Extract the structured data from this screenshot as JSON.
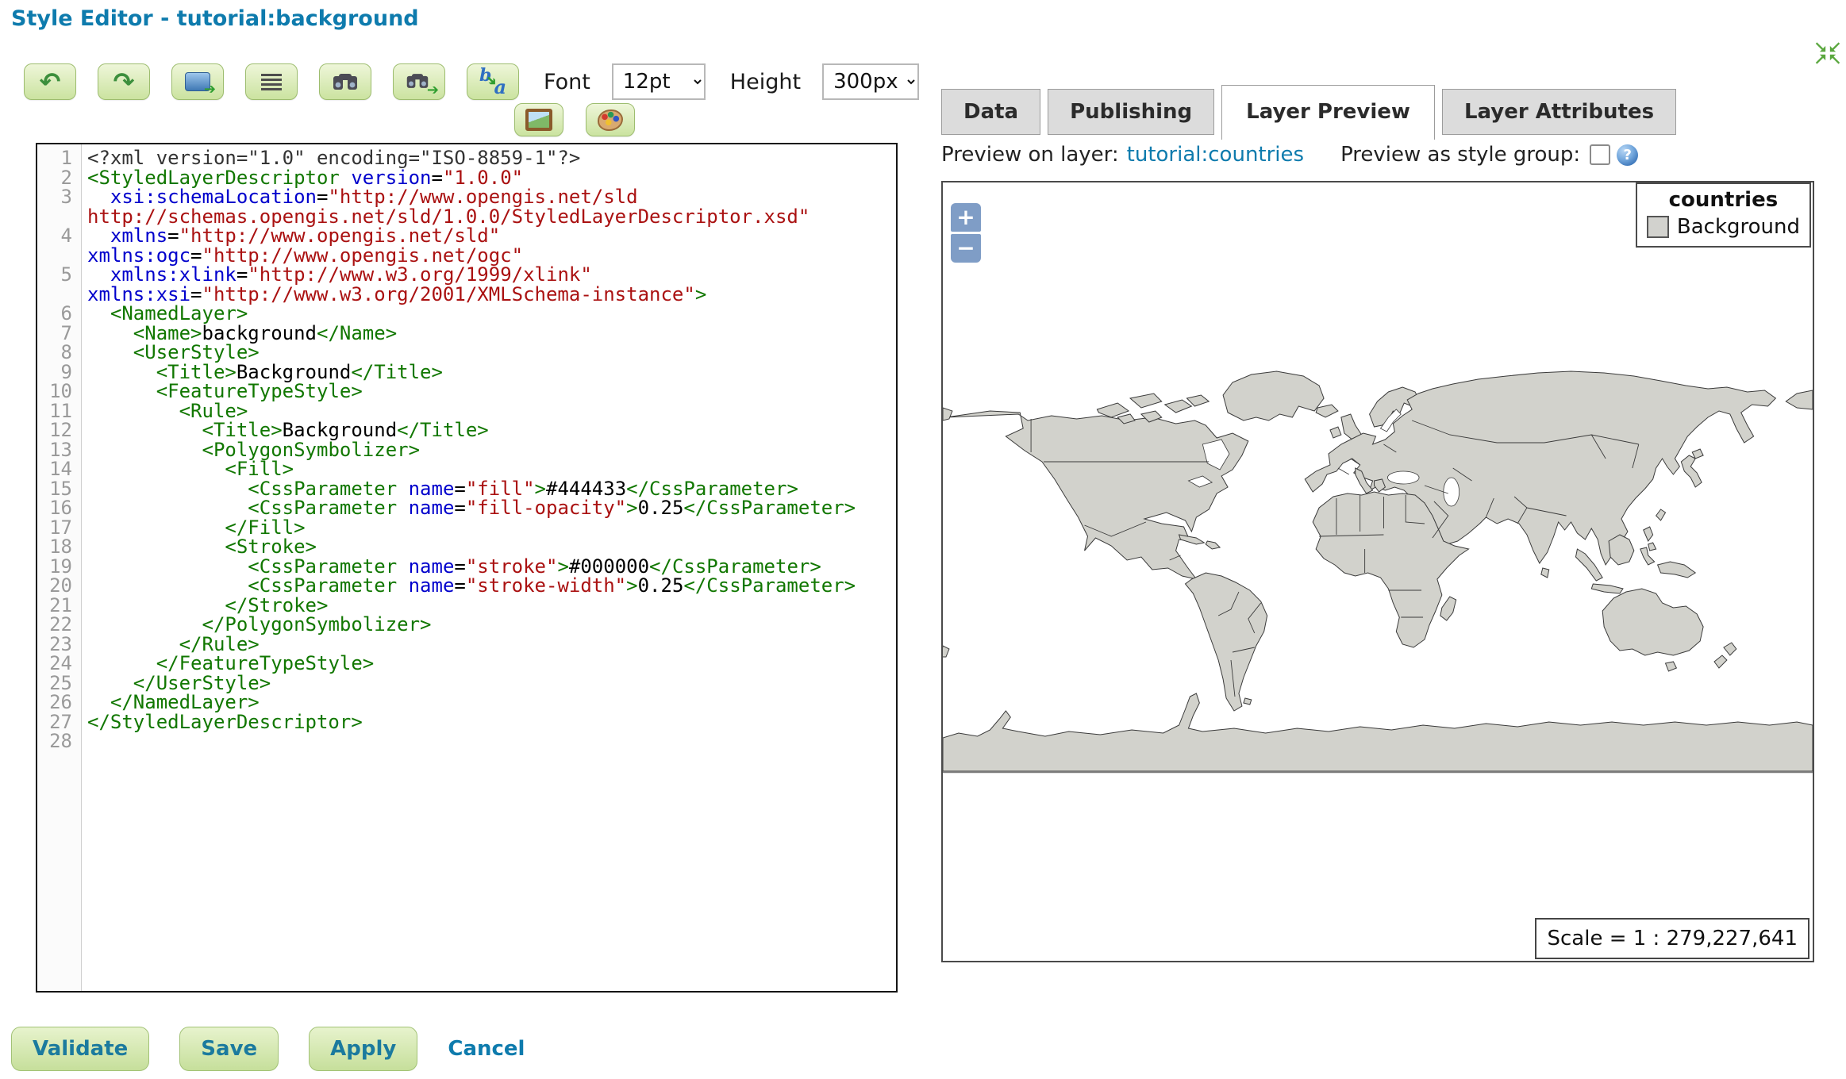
{
  "title": "Style Editor - tutorial:background",
  "colors": {
    "title_accent": "#0e7bad",
    "button_text": "#1b7a9e",
    "button_green": "#cbe3a0",
    "link": "#0e7bad",
    "syntax_tag": "#117700",
    "syntax_attribute": "#0000cc",
    "syntax_string": "#aa1111"
  },
  "toolbar": {
    "font_label": "Font",
    "font_value": "12pt",
    "height_label": "Height",
    "height_value": "300px",
    "buttons": [
      {
        "name": "undo"
      },
      {
        "name": "redo"
      },
      {
        "name": "reformat-xml"
      },
      {
        "name": "auto-indent"
      },
      {
        "name": "find"
      },
      {
        "name": "find-next"
      },
      {
        "name": "find-replace"
      },
      {
        "name": "insert-image"
      },
      {
        "name": "color-picker"
      }
    ],
    "undo_glyph": "↶",
    "redo_glyph": "↷"
  },
  "editor": {
    "lines": [
      {
        "n": 1,
        "t": [
          [
            "meta",
            "<?xml version=\"1.0\" encoding=\"ISO-8859-1\"?>"
          ]
        ]
      },
      {
        "n": 2,
        "t": [
          [
            "tag",
            "<StyledLayerDescriptor"
          ],
          [
            "text",
            " "
          ],
          [
            "attr",
            "version"
          ],
          [
            "text",
            "="
          ],
          [
            "str",
            "\"1.0.0\""
          ]
        ]
      },
      {
        "n": 3,
        "t": [
          [
            "text",
            "  "
          ],
          [
            "attr",
            "xsi:schemaLocation"
          ],
          [
            "text",
            "="
          ],
          [
            "str",
            "\"http://www.opengis.net/sld http://schemas.opengis.net/sld/1.0.0/StyledLayerDescriptor.xsd\""
          ]
        ]
      },
      {
        "n": 4,
        "t": [
          [
            "text",
            "  "
          ],
          [
            "attr",
            "xmlns"
          ],
          [
            "text",
            "="
          ],
          [
            "str",
            "\"http://www.opengis.net/sld\""
          ],
          [
            "text",
            " "
          ],
          [
            "attr",
            "xmlns:ogc"
          ],
          [
            "text",
            "="
          ],
          [
            "str",
            "\"http://www.opengis.net/ogc\""
          ]
        ]
      },
      {
        "n": 5,
        "t": [
          [
            "text",
            "  "
          ],
          [
            "attr",
            "xmlns:xlink"
          ],
          [
            "text",
            "="
          ],
          [
            "str",
            "\"http://www.w3.org/1999/xlink\""
          ],
          [
            "text",
            " "
          ],
          [
            "attr",
            "xmlns:xsi"
          ],
          [
            "text",
            "="
          ],
          [
            "str",
            "\"http://www.w3.org/2001/XMLSchema-instance\""
          ],
          [
            "tag",
            ">"
          ]
        ]
      },
      {
        "n": 6,
        "t": [
          [
            "text",
            "  "
          ],
          [
            "tag",
            "<NamedLayer>"
          ]
        ]
      },
      {
        "n": 7,
        "t": [
          [
            "text",
            "    "
          ],
          [
            "tag",
            "<Name>"
          ],
          [
            "text",
            "background"
          ],
          [
            "tag",
            "</Name>"
          ]
        ]
      },
      {
        "n": 8,
        "t": [
          [
            "text",
            "    "
          ],
          [
            "tag",
            "<UserStyle>"
          ]
        ]
      },
      {
        "n": 9,
        "t": [
          [
            "text",
            "      "
          ],
          [
            "tag",
            "<Title>"
          ],
          [
            "text",
            "Background"
          ],
          [
            "tag",
            "</Title>"
          ]
        ]
      },
      {
        "n": 10,
        "t": [
          [
            "text",
            "      "
          ],
          [
            "tag",
            "<FeatureTypeStyle>"
          ]
        ]
      },
      {
        "n": 11,
        "t": [
          [
            "text",
            "        "
          ],
          [
            "tag",
            "<Rule>"
          ]
        ]
      },
      {
        "n": 12,
        "t": [
          [
            "text",
            "          "
          ],
          [
            "tag",
            "<Title>"
          ],
          [
            "text",
            "Background"
          ],
          [
            "tag",
            "</Title>"
          ]
        ]
      },
      {
        "n": 13,
        "t": [
          [
            "text",
            "          "
          ],
          [
            "tag",
            "<PolygonSymbolizer>"
          ]
        ]
      },
      {
        "n": 14,
        "t": [
          [
            "text",
            "            "
          ],
          [
            "tag",
            "<Fill>"
          ]
        ]
      },
      {
        "n": 15,
        "t": [
          [
            "text",
            "              "
          ],
          [
            "tag",
            "<CssParameter"
          ],
          [
            "text",
            " "
          ],
          [
            "attr",
            "name"
          ],
          [
            "text",
            "="
          ],
          [
            "str",
            "\"fill\""
          ],
          [
            "tag",
            ">"
          ],
          [
            "text",
            "#444433"
          ],
          [
            "tag",
            "</CssParameter>"
          ]
        ]
      },
      {
        "n": 16,
        "t": [
          [
            "text",
            "              "
          ],
          [
            "tag",
            "<CssParameter"
          ],
          [
            "text",
            " "
          ],
          [
            "attr",
            "name"
          ],
          [
            "text",
            "="
          ],
          [
            "str",
            "\"fill-opacity\""
          ],
          [
            "tag",
            ">"
          ],
          [
            "text",
            "0.25"
          ],
          [
            "tag",
            "</CssParameter>"
          ]
        ]
      },
      {
        "n": 17,
        "t": [
          [
            "text",
            "            "
          ],
          [
            "tag",
            "</Fill>"
          ]
        ]
      },
      {
        "n": 18,
        "t": [
          [
            "text",
            "            "
          ],
          [
            "tag",
            "<Stroke>"
          ]
        ]
      },
      {
        "n": 19,
        "t": [
          [
            "text",
            "              "
          ],
          [
            "tag",
            "<CssParameter"
          ],
          [
            "text",
            " "
          ],
          [
            "attr",
            "name"
          ],
          [
            "text",
            "="
          ],
          [
            "str",
            "\"stroke\""
          ],
          [
            "tag",
            ">"
          ],
          [
            "text",
            "#000000"
          ],
          [
            "tag",
            "</CssParameter>"
          ]
        ]
      },
      {
        "n": 20,
        "t": [
          [
            "text",
            "              "
          ],
          [
            "tag",
            "<CssParameter"
          ],
          [
            "text",
            " "
          ],
          [
            "attr",
            "name"
          ],
          [
            "text",
            "="
          ],
          [
            "str",
            "\"stroke-width\""
          ],
          [
            "tag",
            ">"
          ],
          [
            "text",
            "0.25"
          ],
          [
            "tag",
            "</CssParameter>"
          ]
        ]
      },
      {
        "n": 21,
        "t": [
          [
            "text",
            "            "
          ],
          [
            "tag",
            "</Stroke>"
          ]
        ]
      },
      {
        "n": 22,
        "t": [
          [
            "text",
            "          "
          ],
          [
            "tag",
            "</PolygonSymbolizer>"
          ]
        ]
      },
      {
        "n": 23,
        "t": [
          [
            "text",
            "        "
          ],
          [
            "tag",
            "</Rule>"
          ]
        ]
      },
      {
        "n": 24,
        "t": [
          [
            "text",
            "      "
          ],
          [
            "tag",
            "</FeatureTypeStyle>"
          ]
        ]
      },
      {
        "n": 25,
        "t": [
          [
            "text",
            "    "
          ],
          [
            "tag",
            "</UserStyle>"
          ]
        ]
      },
      {
        "n": 26,
        "t": [
          [
            "text",
            "  "
          ],
          [
            "tag",
            "</NamedLayer>"
          ]
        ]
      },
      {
        "n": 27,
        "t": [
          [
            "tag",
            "</StyledLayerDescriptor>"
          ]
        ]
      },
      {
        "n": 28,
        "t": []
      }
    ]
  },
  "actions": {
    "validate": "Validate",
    "save": "Save",
    "apply": "Apply",
    "cancel": "Cancel"
  },
  "tabs": [
    {
      "label": "Data",
      "active": false
    },
    {
      "label": "Publishing",
      "active": false
    },
    {
      "label": "Layer Preview",
      "active": true
    },
    {
      "label": "Layer Attributes",
      "active": false
    }
  ],
  "preview": {
    "on_layer_label": "Preview on layer:",
    "layer_link": "tutorial:countries",
    "style_group_label": "Preview as style group:",
    "style_group_checked": false,
    "zoom_in": "+",
    "zoom_out": "−",
    "legend": {
      "title": "countries",
      "entries": [
        {
          "label": "Background",
          "swatch": "#d2d2ce"
        }
      ]
    },
    "scale_text": "Scale = 1 : 279,227,641",
    "map": {
      "land_fill": "#d2d2cc",
      "land_stroke": "#3a3a3a",
      "ocean": "#ffffff"
    }
  }
}
